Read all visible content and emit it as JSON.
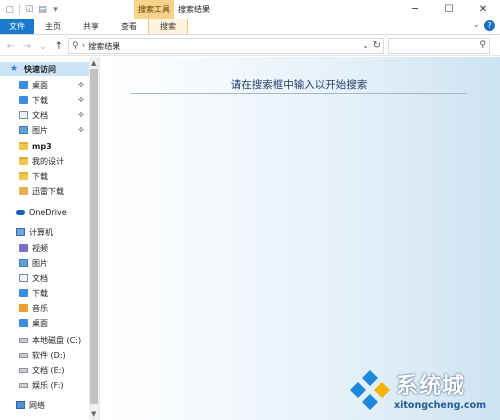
{
  "window": {
    "title": "搜索结果",
    "context_tab_group": "搜索工具"
  },
  "ribbon": {
    "tabs": [
      "文件",
      "主页",
      "共享",
      "查看",
      "搜索"
    ]
  },
  "address": {
    "path": "搜索结果",
    "search_placeholder": ""
  },
  "sidebar": {
    "quick_access": "快速访问",
    "quick_items": [
      "桌面",
      "下载",
      "文档",
      "图片",
      "mp3",
      "我的设计",
      "下载",
      "迅雷下载"
    ],
    "onedrive": "OneDrive",
    "computer": "计算机",
    "computer_items": [
      "视频",
      "图片",
      "文档",
      "下载",
      "音乐",
      "桌面",
      "本地磁盘 (C:)",
      "软件 (D:)",
      "文档 (E:)",
      "娱乐 (F:)"
    ],
    "network": "网络"
  },
  "main": {
    "hint": "请在搜索框中输入以开始搜索"
  },
  "watermark": {
    "brand": "系统城",
    "url": "xitongcheng.com"
  }
}
